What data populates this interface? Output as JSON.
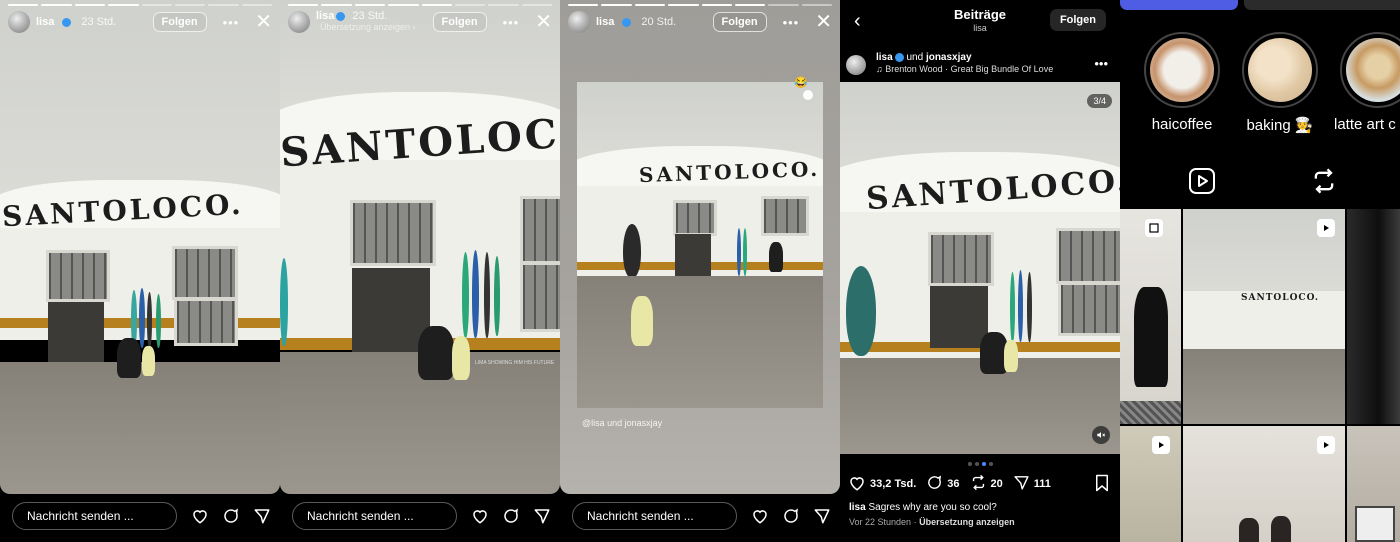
{
  "stories": [
    {
      "user": "lisa",
      "time": "23 Std.",
      "follow": "Folgen",
      "subline": "",
      "overlay_text": ""
    },
    {
      "user": "lisa",
      "time": "23 Std.",
      "follow": "Folgen",
      "subline": "Übersetzung anzeigen ›",
      "overlay_text": "LIMA SHOWING HIM HIS FUTURE"
    },
    {
      "user": "lisa",
      "time": "20 Std.",
      "follow": "Folgen",
      "subline": "",
      "overlay_text": "@lisa und jonasxjay",
      "emoji": "😂"
    }
  ],
  "story_bar": {
    "placeholder": "Nachricht senden ..."
  },
  "sign_text": "SANTOLOCO.",
  "post": {
    "header_title": "Beiträge",
    "header_sub": "lisa",
    "follow": "Folgen",
    "author": "lisa",
    "and_text": "und",
    "coauthor": "jonasxjay",
    "music": "Brenton Wood · Great Big Bundle Of Love",
    "counter": "3/4",
    "likes": "33,2 Tsd.",
    "comments": "36",
    "reposts": "20",
    "shares": "111",
    "caption_user": "lisa",
    "caption_text": "Sagres why are you so cool?",
    "meta_time": "Vor 22 Stunden",
    "meta_sep": "·",
    "meta_translate": "Übersetzung anzeigen",
    "carousel_total": 4,
    "carousel_index": 3
  },
  "profile": {
    "highlights": [
      {
        "label": "haicoffee"
      },
      {
        "label": "baking 🧑‍🍳"
      },
      {
        "label": "latte art c"
      }
    ]
  },
  "colors": {
    "accent": "#3897f0",
    "dot_active": "#4c8cff",
    "story_bar_bg": "#000000"
  }
}
